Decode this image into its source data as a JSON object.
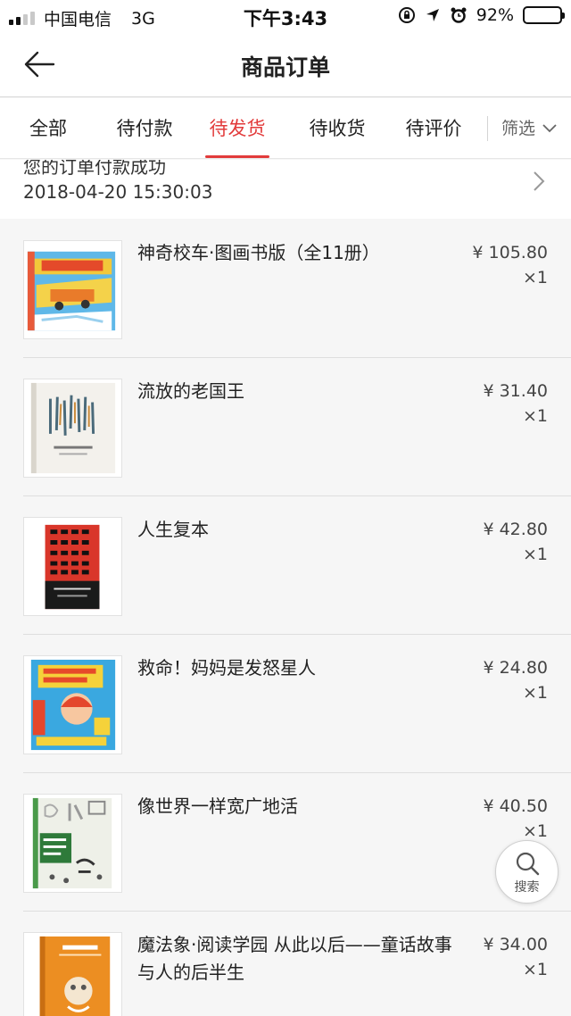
{
  "status_bar": {
    "carrier": "中国电信",
    "network": "3G",
    "time": "下午3:43",
    "battery": "92%",
    "battery_level": 0.92
  },
  "nav": {
    "title": "商品订单",
    "back_icon": "back-arrow-icon"
  },
  "tabs": [
    {
      "label": "全部",
      "active": false
    },
    {
      "label": "待付款",
      "active": false
    },
    {
      "label": "待发货",
      "active": true
    },
    {
      "label": "待收货",
      "active": false
    },
    {
      "label": "待评价",
      "active": false
    }
  ],
  "filter": {
    "label": "筛选",
    "icon": "chevron-down-icon"
  },
  "order": {
    "status": "您的订单付款成功",
    "datetime": "2018-04-20 15:30:03"
  },
  "items": [
    {
      "name": "神奇校车·图画书版（全11册）",
      "price": "¥ 105.80",
      "qty": "×1"
    },
    {
      "name": "流放的老国王",
      "price": "¥ 31.40",
      "qty": "×1"
    },
    {
      "name": "人生复本",
      "price": "¥ 42.80",
      "qty": "×1"
    },
    {
      "name": "救命！妈妈是发怒星人",
      "price": "¥ 24.80",
      "qty": "×1"
    },
    {
      "name": "像世界一样宽广地活",
      "price": "¥ 40.50",
      "qty": "×1"
    },
    {
      "name": "魔法象·阅读学园 从此以后——童话故事与人的后半生",
      "price": "¥ 34.00",
      "qty": "×1"
    }
  ],
  "search_fab": {
    "label": "搜索",
    "icon": "search-icon"
  },
  "colors": {
    "accent": "#e23b3b",
    "background": "#f6f6f6"
  }
}
